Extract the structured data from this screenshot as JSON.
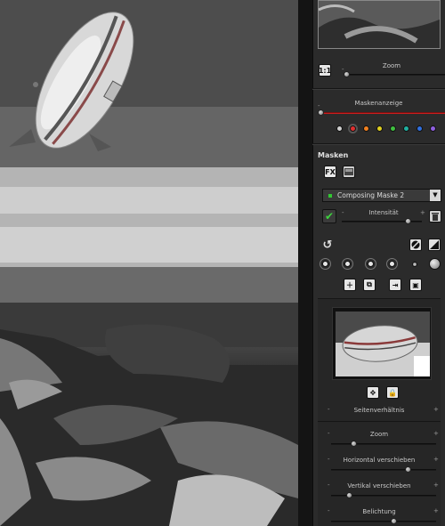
{
  "panel": {
    "zoom_section": {
      "one_to_one_label": "1:1",
      "zoom_label": "Zoom",
      "minus": "-",
      "plus": "+"
    },
    "mask_display": {
      "label": "Maskenanzeige",
      "minus": "-",
      "colors": [
        "#d0d0d0",
        "#e03030",
        "#f08020",
        "#e0d020",
        "#40c040",
        "#20b0a0",
        "#3070e0",
        "#9060e0"
      ],
      "accent": "#c81e1e"
    },
    "masks": {
      "title": "Masken",
      "fx_label": "FX",
      "selected_mask": "Composing Maske 2",
      "intensity_label": "Intensität",
      "minus": "-",
      "plus": "+"
    },
    "aspect_label": "Seitenverhältnis",
    "sliders": [
      {
        "label": "Zoom",
        "value": 0.2
      },
      {
        "label": "Horizontal verschieben",
        "value": 0.75
      },
      {
        "label": "Vertikal verschieben",
        "value": 0.15
      },
      {
        "label": "Belichtung",
        "value": 0.6
      }
    ],
    "minus": "-",
    "plus": "+"
  },
  "icons": [
    "one-to-one-icon",
    "fx-icon",
    "layer-icon",
    "trash-icon",
    "check-icon",
    "undo-icon",
    "invert-icon",
    "gradient-icon",
    "add-mask-icon",
    "copy-mask-icon",
    "import-mask-icon",
    "save-mask-icon",
    "fit-icon",
    "lock-icon"
  ]
}
